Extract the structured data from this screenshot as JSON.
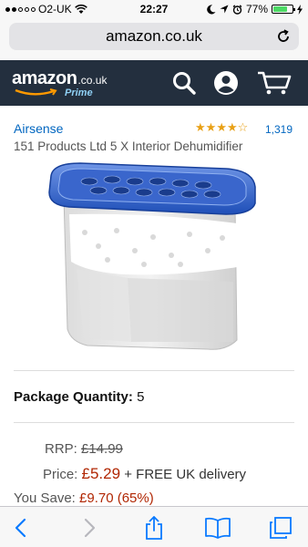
{
  "status_bar": {
    "carrier": "O2-UK",
    "time": "22:27",
    "battery_percent": "77%",
    "battery_level": 0.77,
    "signal_bars_filled": 2,
    "signal_bars_total": 5,
    "icons": [
      "wifi-icon",
      "moon-icon",
      "location-icon",
      "alarm-icon",
      "battery-icon",
      "charging-icon"
    ]
  },
  "browser": {
    "url": "amazon.co.uk",
    "reload_icon": "reload-icon"
  },
  "header": {
    "logo_text": "amazon",
    "logo_tld": ".co.uk",
    "logo_prime": "Prime",
    "icons": [
      "search-icon",
      "account-icon",
      "cart-icon"
    ],
    "background": "#232f3e"
  },
  "product": {
    "brand": "Airsense",
    "rating_stars": 4,
    "rating_max": 5,
    "rating_count": "1,319",
    "title": "151 Products Ltd 5 X Interior Dehumidifier",
    "image_alt": "product-image"
  },
  "package": {
    "label": "Package Quantity:",
    "value": "5"
  },
  "pricing": {
    "rrp_label": "RRP:",
    "rrp_value": "£14.99",
    "price_label": "Price:",
    "price_value": "£5.29",
    "delivery_text": "+ FREE UK delivery",
    "save_label": "You Save:",
    "save_value": "£9.70 (65%)",
    "accent_color": "#b12704"
  },
  "toolbar": {
    "icons": [
      "back-icon",
      "forward-icon",
      "share-icon",
      "bookmarks-icon",
      "tabs-icon"
    ]
  }
}
